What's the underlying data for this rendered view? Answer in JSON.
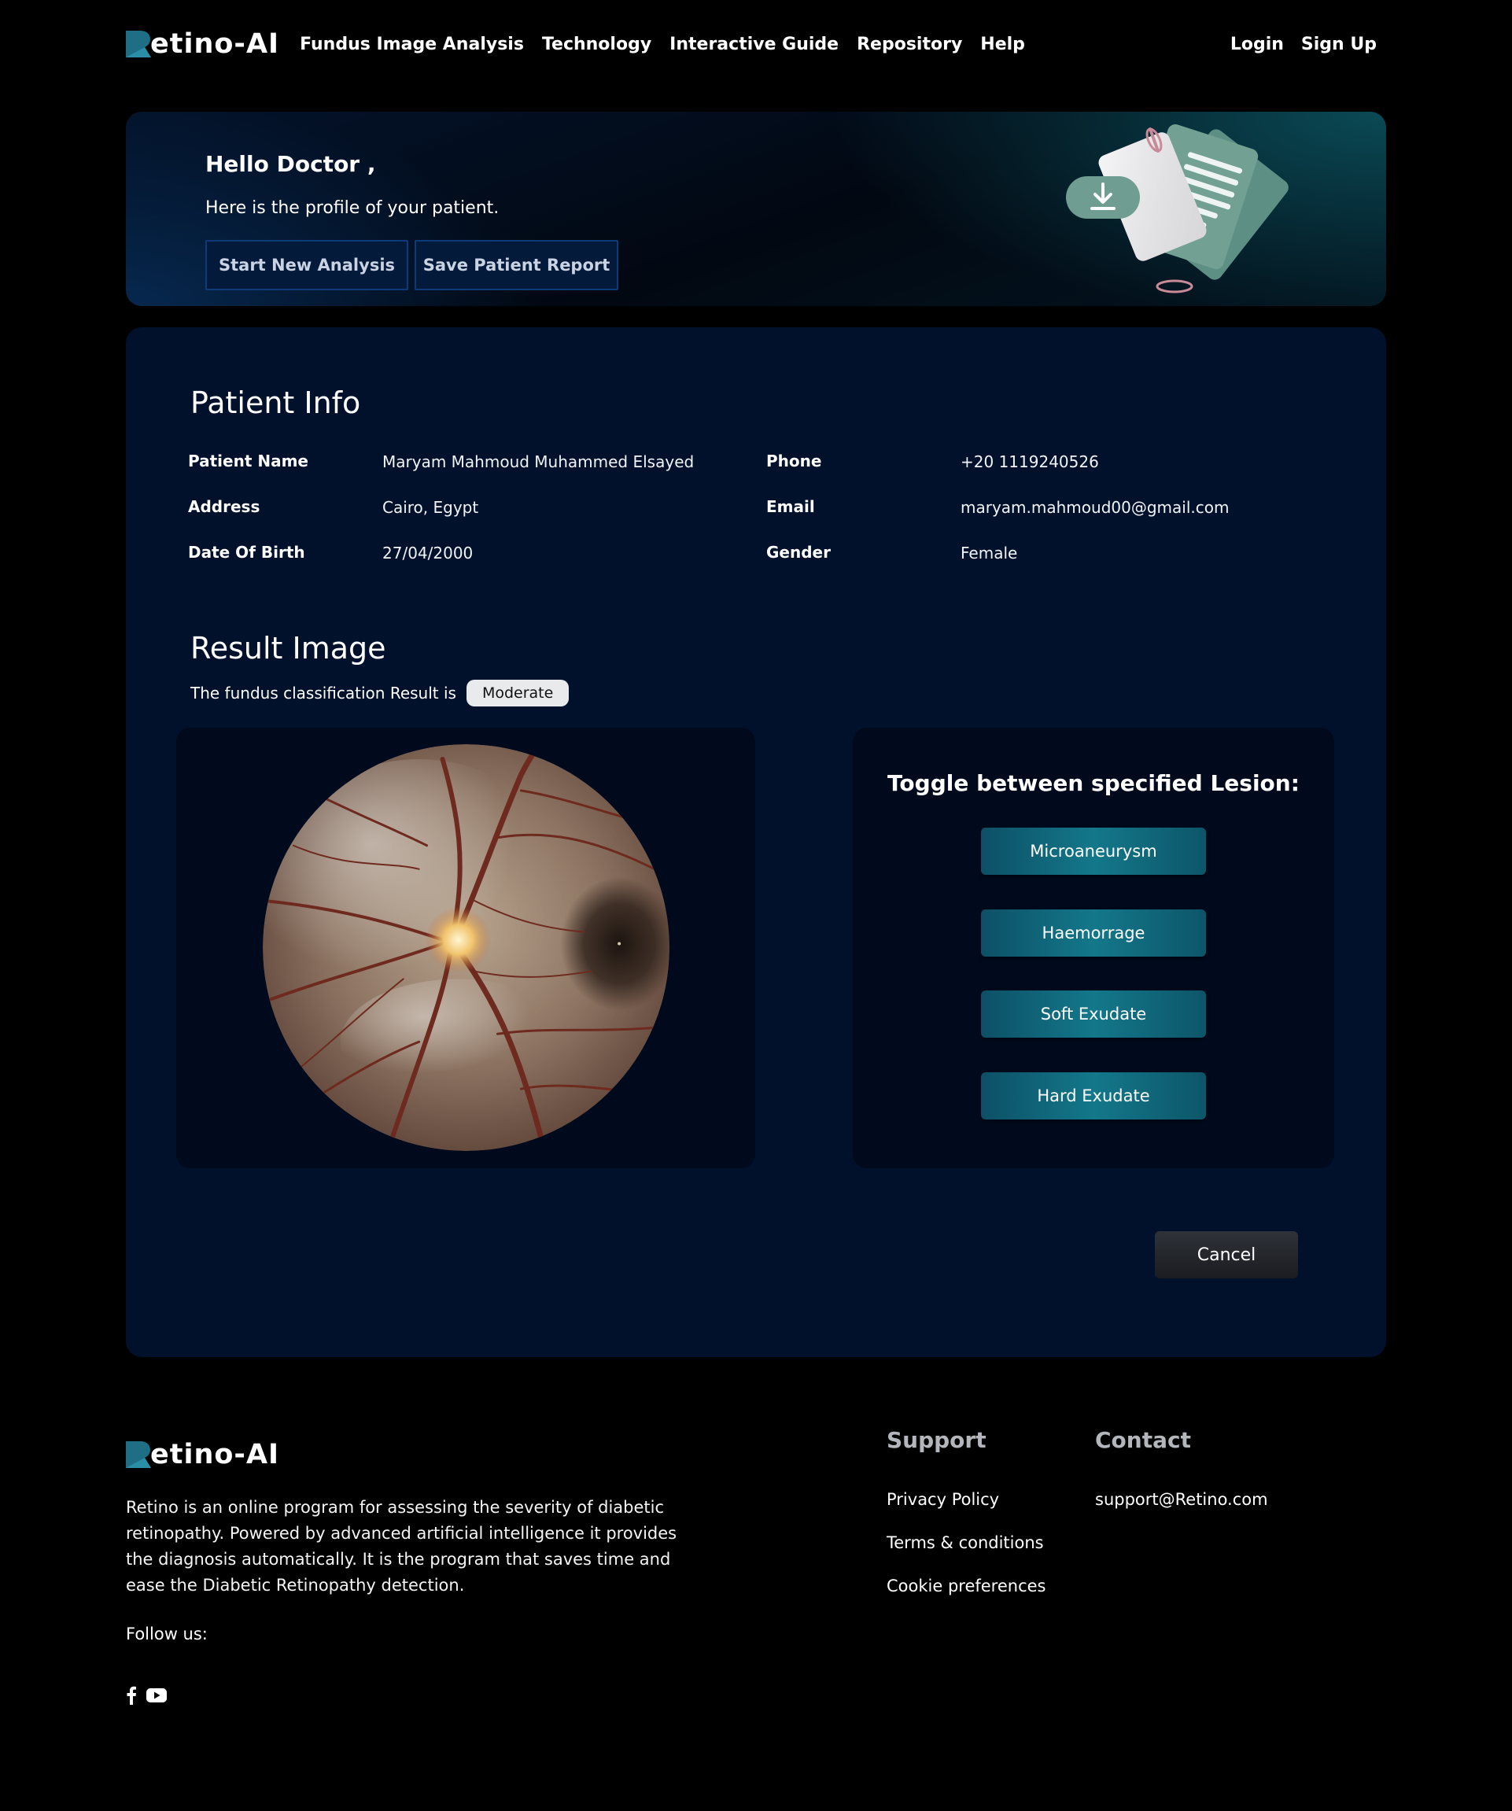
{
  "brand": {
    "name": "etino-AI",
    "brand_color": "#1e6f86"
  },
  "nav": {
    "links": [
      "Fundus Image Analysis",
      "Technology",
      "Interactive Guide",
      "Repository",
      "Help"
    ],
    "login": "Login",
    "signup": "Sign Up"
  },
  "hero": {
    "greeting": "Hello Doctor ,",
    "subtitle": "Here is the profile of your patient.",
    "start_button": "Start New Analysis",
    "save_button": "Save Patient Report",
    "illustration_icon": "download-report-icon"
  },
  "patient_info": {
    "title": "Patient Info",
    "fields": {
      "name": {
        "label": "Patient Name",
        "value": "Maryam Mahmoud Muhammed Elsayed"
      },
      "address": {
        "label": "Address",
        "value": "Cairo, Egypt"
      },
      "dob": {
        "label": "Date Of Birth",
        "value": "27/04/2000"
      },
      "phone": {
        "label": "Phone",
        "value": "+20 1119240526"
      },
      "email": {
        "label": "Email",
        "value": "maryam.mahmoud00@gmail.com"
      },
      "gender": {
        "label": "Gender",
        "value": "Female"
      }
    }
  },
  "result": {
    "title": "Result Image",
    "text": "The fundus classification Result is",
    "classification": "Moderate",
    "toggle_title": "Toggle between specified Lesion:",
    "lesions": [
      "Microaneurysm",
      "Haemorrage",
      "Soft Exudate",
      "Hard Exudate"
    ],
    "cancel": "Cancel"
  },
  "footer": {
    "brand": "etino-AI",
    "description": "Retino is an online program for assessing the severity of diabetic retinopathy. Powered by advanced artificial intelligence it provides the diagnosis automatically. It is the program that saves time and ease the Diabetic Retinopathy detection.",
    "follow": "Follow us:",
    "social_icons": [
      "facebook-icon",
      "youtube-icon"
    ],
    "support": {
      "title": "Support",
      "links": [
        "Privacy Policy",
        "Terms & conditions",
        "Cookie preferences"
      ]
    },
    "contact": {
      "title": "Contact",
      "email": "support@Retino.com"
    }
  }
}
